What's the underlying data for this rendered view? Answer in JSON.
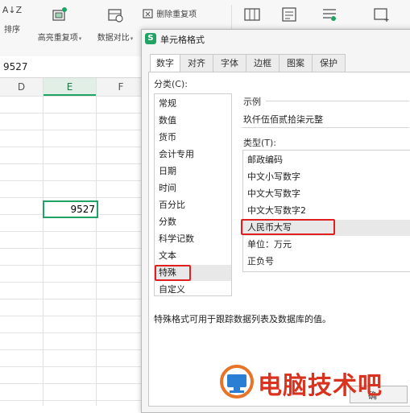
{
  "ribbon": {
    "sort_label": "排序",
    "sort_icon_text": "A↓Z",
    "highlight_label": "高亮重复项",
    "compare_label": "数据对比",
    "delete_dup_label": "删除重复项"
  },
  "formula_bar": {
    "value": "9527"
  },
  "sheet": {
    "columns": [
      "D",
      "E",
      "F"
    ],
    "active_cell_value": "9527",
    "accent_color": "#21a366"
  },
  "dialog": {
    "title": "单元格格式",
    "tabs": [
      "数字",
      "对齐",
      "字体",
      "边框",
      "图案",
      "保护"
    ],
    "category_label": "分类(C):",
    "categories": [
      "常规",
      "数值",
      "货币",
      "会计专用",
      "日期",
      "时间",
      "百分比",
      "分数",
      "科学记数",
      "文本",
      "特殊",
      "自定义"
    ],
    "selected_category": "特殊",
    "sample_label": "示例",
    "sample_value": "玖仟伍佰贰拾柒元整",
    "type_label": "类型(T):",
    "types": [
      "邮政编码",
      "中文小写数字",
      "中文大写数字",
      "中文大写数字2",
      "人民币大写",
      "单位：万元",
      "正负号"
    ],
    "selected_type": "人民币大写",
    "description": "特殊格式可用于跟踪数据列表及数据库的值。",
    "ok_button": "确"
  },
  "watermark": {
    "text": "电脑技术吧",
    "color": "#d9331f"
  },
  "highlight_color": "#e02020"
}
